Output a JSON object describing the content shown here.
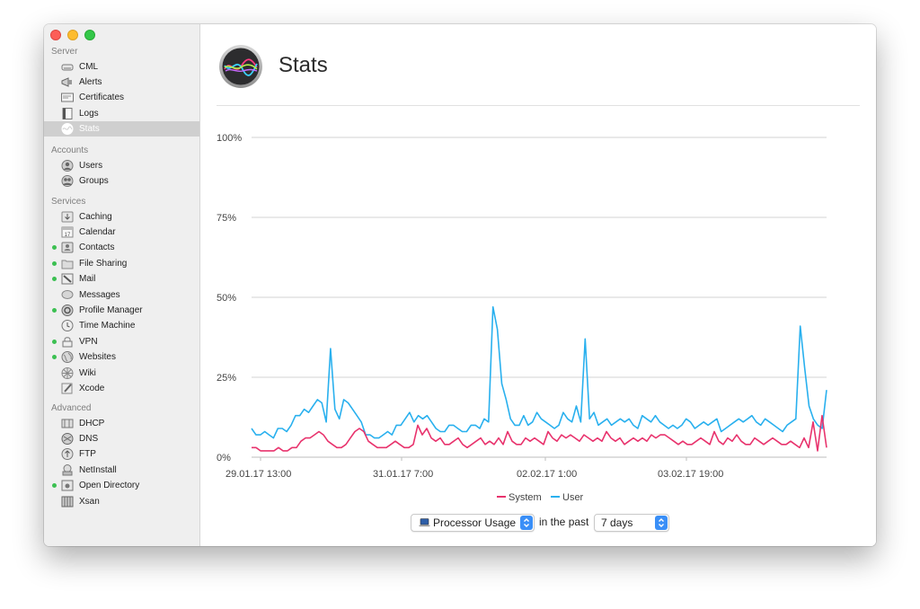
{
  "sidebar": {
    "sections": [
      {
        "title": "Server",
        "items": [
          {
            "label": "CML",
            "icon": "drive-icon",
            "status": false,
            "selected": false
          },
          {
            "label": "Alerts",
            "icon": "megaphone-icon",
            "status": false,
            "selected": false
          },
          {
            "label": "Certificates",
            "icon": "certificate-icon",
            "status": false,
            "selected": false
          },
          {
            "label": "Logs",
            "icon": "log-icon",
            "status": false,
            "selected": false
          },
          {
            "label": "Stats",
            "icon": "stats-icon",
            "status": false,
            "selected": true
          }
        ]
      },
      {
        "title": "Accounts",
        "items": [
          {
            "label": "Users",
            "icon": "user-icon",
            "status": false,
            "selected": false
          },
          {
            "label": "Groups",
            "icon": "group-icon",
            "status": false,
            "selected": false
          }
        ]
      },
      {
        "title": "Services",
        "items": [
          {
            "label": "Caching",
            "icon": "caching-icon",
            "status": false,
            "selected": false
          },
          {
            "label": "Calendar",
            "icon": "calendar-icon",
            "status": false,
            "selected": false
          },
          {
            "label": "Contacts",
            "icon": "contacts-icon",
            "status": true,
            "selected": false
          },
          {
            "label": "File Sharing",
            "icon": "folder-icon",
            "status": true,
            "selected": false
          },
          {
            "label": "Mail",
            "icon": "mail-icon",
            "status": true,
            "selected": false
          },
          {
            "label": "Messages",
            "icon": "messages-icon",
            "status": false,
            "selected": false
          },
          {
            "label": "Profile Manager",
            "icon": "profile-manager-icon",
            "status": true,
            "selected": false
          },
          {
            "label": "Time Machine",
            "icon": "time-machine-icon",
            "status": false,
            "selected": false
          },
          {
            "label": "VPN",
            "icon": "vpn-icon",
            "status": true,
            "selected": false
          },
          {
            "label": "Websites",
            "icon": "globe-icon",
            "status": true,
            "selected": false
          },
          {
            "label": "Wiki",
            "icon": "wiki-icon",
            "status": false,
            "selected": false
          },
          {
            "label": "Xcode",
            "icon": "xcode-icon",
            "status": false,
            "selected": false
          }
        ]
      },
      {
        "title": "Advanced",
        "items": [
          {
            "label": "DHCP",
            "icon": "dhcp-icon",
            "status": false,
            "selected": false
          },
          {
            "label": "DNS",
            "icon": "dns-icon",
            "status": false,
            "selected": false
          },
          {
            "label": "FTP",
            "icon": "ftp-icon",
            "status": false,
            "selected": false
          },
          {
            "label": "NetInstall",
            "icon": "netinstall-icon",
            "status": false,
            "selected": false
          },
          {
            "label": "Open Directory",
            "icon": "open-directory-icon",
            "status": true,
            "selected": false
          },
          {
            "label": "Xsan",
            "icon": "xsan-icon",
            "status": false,
            "selected": false
          }
        ]
      }
    ]
  },
  "header": {
    "title": "Stats",
    "icon": "stats-icon"
  },
  "controls": {
    "metric": "Processor Usage",
    "metric_icon": "laptop-icon",
    "connector": "in the past",
    "period": "7 days"
  },
  "colors": {
    "system": "#e8336d",
    "user": "#29b0ee",
    "status_dot": "#3cc052",
    "accent": "#3a8ff7"
  },
  "chart_data": {
    "type": "line",
    "title": "",
    "xlabel": "",
    "ylabel": "",
    "ylim": [
      0,
      100
    ],
    "y_ticks": [
      "0%",
      "25%",
      "50%",
      "75%",
      "100%"
    ],
    "x_tick_labels": [
      "29.01.17 13:00",
      "31.01.17 7:00",
      "02.02.17 1:00",
      "03.02.17 19:00"
    ],
    "legend": {
      "position": "bottom"
    },
    "series": [
      {
        "name": "System",
        "color": "#e8336d",
        "values": [
          3,
          3,
          2,
          2,
          2,
          2,
          3,
          2,
          2,
          3,
          3,
          5,
          6,
          6,
          7,
          8,
          7,
          5,
          4,
          3,
          3,
          4,
          6,
          8,
          9,
          8,
          5,
          4,
          3,
          3,
          3,
          4,
          5,
          4,
          3,
          3,
          4,
          10,
          7,
          9,
          6,
          5,
          6,
          4,
          4,
          5,
          6,
          4,
          3,
          4,
          5,
          6,
          4,
          5,
          4,
          6,
          4,
          8,
          5,
          4,
          4,
          6,
          5,
          6,
          5,
          4,
          8,
          6,
          5,
          7,
          6,
          7,
          6,
          5,
          7,
          6,
          5,
          6,
          5,
          8,
          6,
          5,
          6,
          4,
          5,
          6,
          5,
          6,
          5,
          7,
          6,
          7,
          7,
          6,
          5,
          4,
          5,
          4,
          4,
          5,
          6,
          5,
          4,
          8,
          5,
          4,
          6,
          5,
          7,
          5,
          4,
          4,
          6,
          5,
          4,
          5,
          6,
          5,
          4,
          4,
          5,
          4,
          3,
          6,
          3,
          11,
          2,
          13,
          3
        ]
      },
      {
        "name": "User",
        "color": "#29b0ee",
        "values": [
          9,
          7,
          7,
          8,
          7,
          6,
          9,
          9,
          8,
          10,
          13,
          13,
          15,
          14,
          16,
          18,
          17,
          11,
          34,
          15,
          12,
          18,
          17,
          15,
          13,
          11,
          7,
          7,
          6,
          6,
          7,
          8,
          7,
          10,
          10,
          12,
          14,
          11,
          13,
          12,
          13,
          11,
          9,
          8,
          8,
          10,
          10,
          9,
          8,
          8,
          10,
          10,
          9,
          12,
          11,
          47,
          40,
          23,
          18,
          12,
          10,
          10,
          13,
          10,
          11,
          14,
          12,
          11,
          10,
          9,
          10,
          14,
          12,
          11,
          16,
          11,
          37,
          12,
          14,
          10,
          11,
          12,
          10,
          11,
          12,
          11,
          12,
          10,
          9,
          13,
          12,
          11,
          13,
          11,
          10,
          9,
          10,
          9,
          10,
          12,
          11,
          9,
          10,
          11,
          10,
          11,
          12,
          8,
          9,
          10,
          11,
          12,
          11,
          12,
          13,
          11,
          10,
          12,
          11,
          10,
          9,
          8,
          10,
          11,
          12,
          41,
          28,
          16,
          12,
          10,
          9,
          21
        ]
      }
    ]
  }
}
